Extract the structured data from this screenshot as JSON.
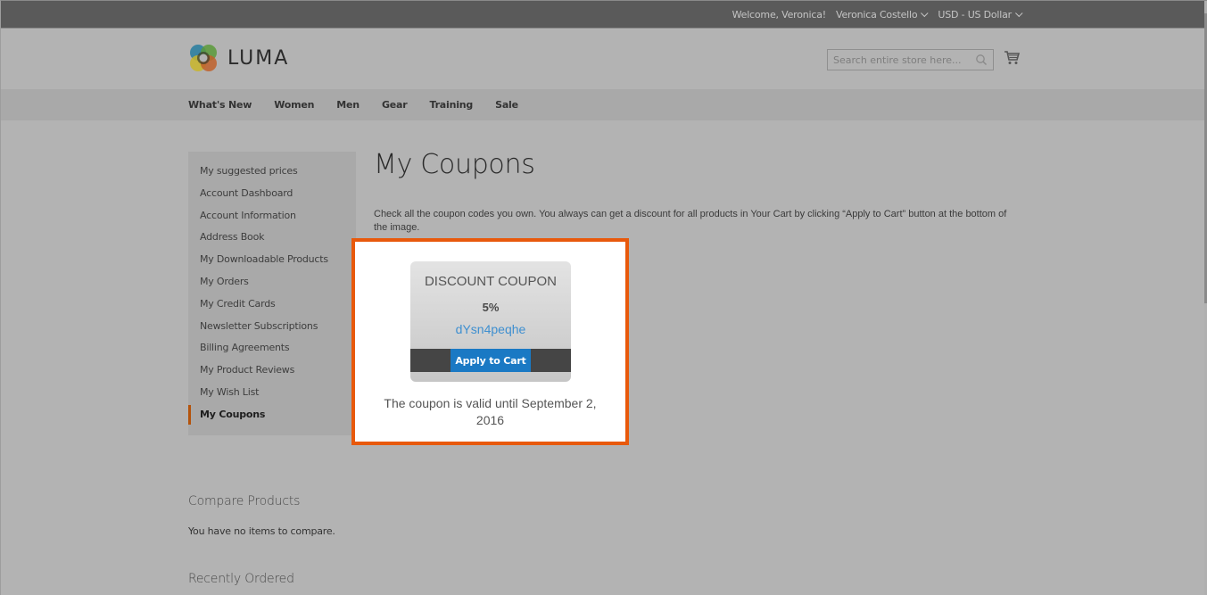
{
  "top_panel": {
    "welcome": "Welcome, Veronica!",
    "account_name": "Veronica Costello",
    "currency": "USD - US Dollar"
  },
  "header": {
    "logo_text": "LUMA",
    "search_placeholder": "Search entire store here...",
    "search_value": ""
  },
  "nav": {
    "items": [
      "What's New",
      "Women",
      "Men",
      "Gear",
      "Training",
      "Sale"
    ]
  },
  "sidebar": {
    "items": [
      "My suggested prices",
      "Account Dashboard",
      "Account Information",
      "Address Book",
      "My Downloadable Products",
      "My Orders",
      "My Credit Cards",
      "Newsletter Subscriptions",
      "Billing Agreements",
      "My Product Reviews",
      "My Wish List",
      "My Coupons"
    ],
    "current": "My Coupons"
  },
  "main": {
    "title": "My Coupons",
    "intro": "Check all the coupon codes you own. You always can get a discount for all products in Your Cart by clicking “Apply to Cart” button at the bottom of the image."
  },
  "coupon": {
    "title": "DISCOUNT COUPON",
    "value": "5%",
    "code": "dYsn4peqhe",
    "apply_label": "Apply to Cart",
    "valid_text": "The coupon is valid until September 2, 2016"
  },
  "compare": {
    "title": "Compare Products",
    "empty_text": "You have no items to compare."
  },
  "recently_ordered": {
    "title": "Recently Ordered"
  },
  "colors": {
    "highlight_border": "#e8590c",
    "apply_button": "#1a79c4",
    "coupon_code": "#3e8fd0",
    "sidebar_current_marker": "#b4530b"
  }
}
